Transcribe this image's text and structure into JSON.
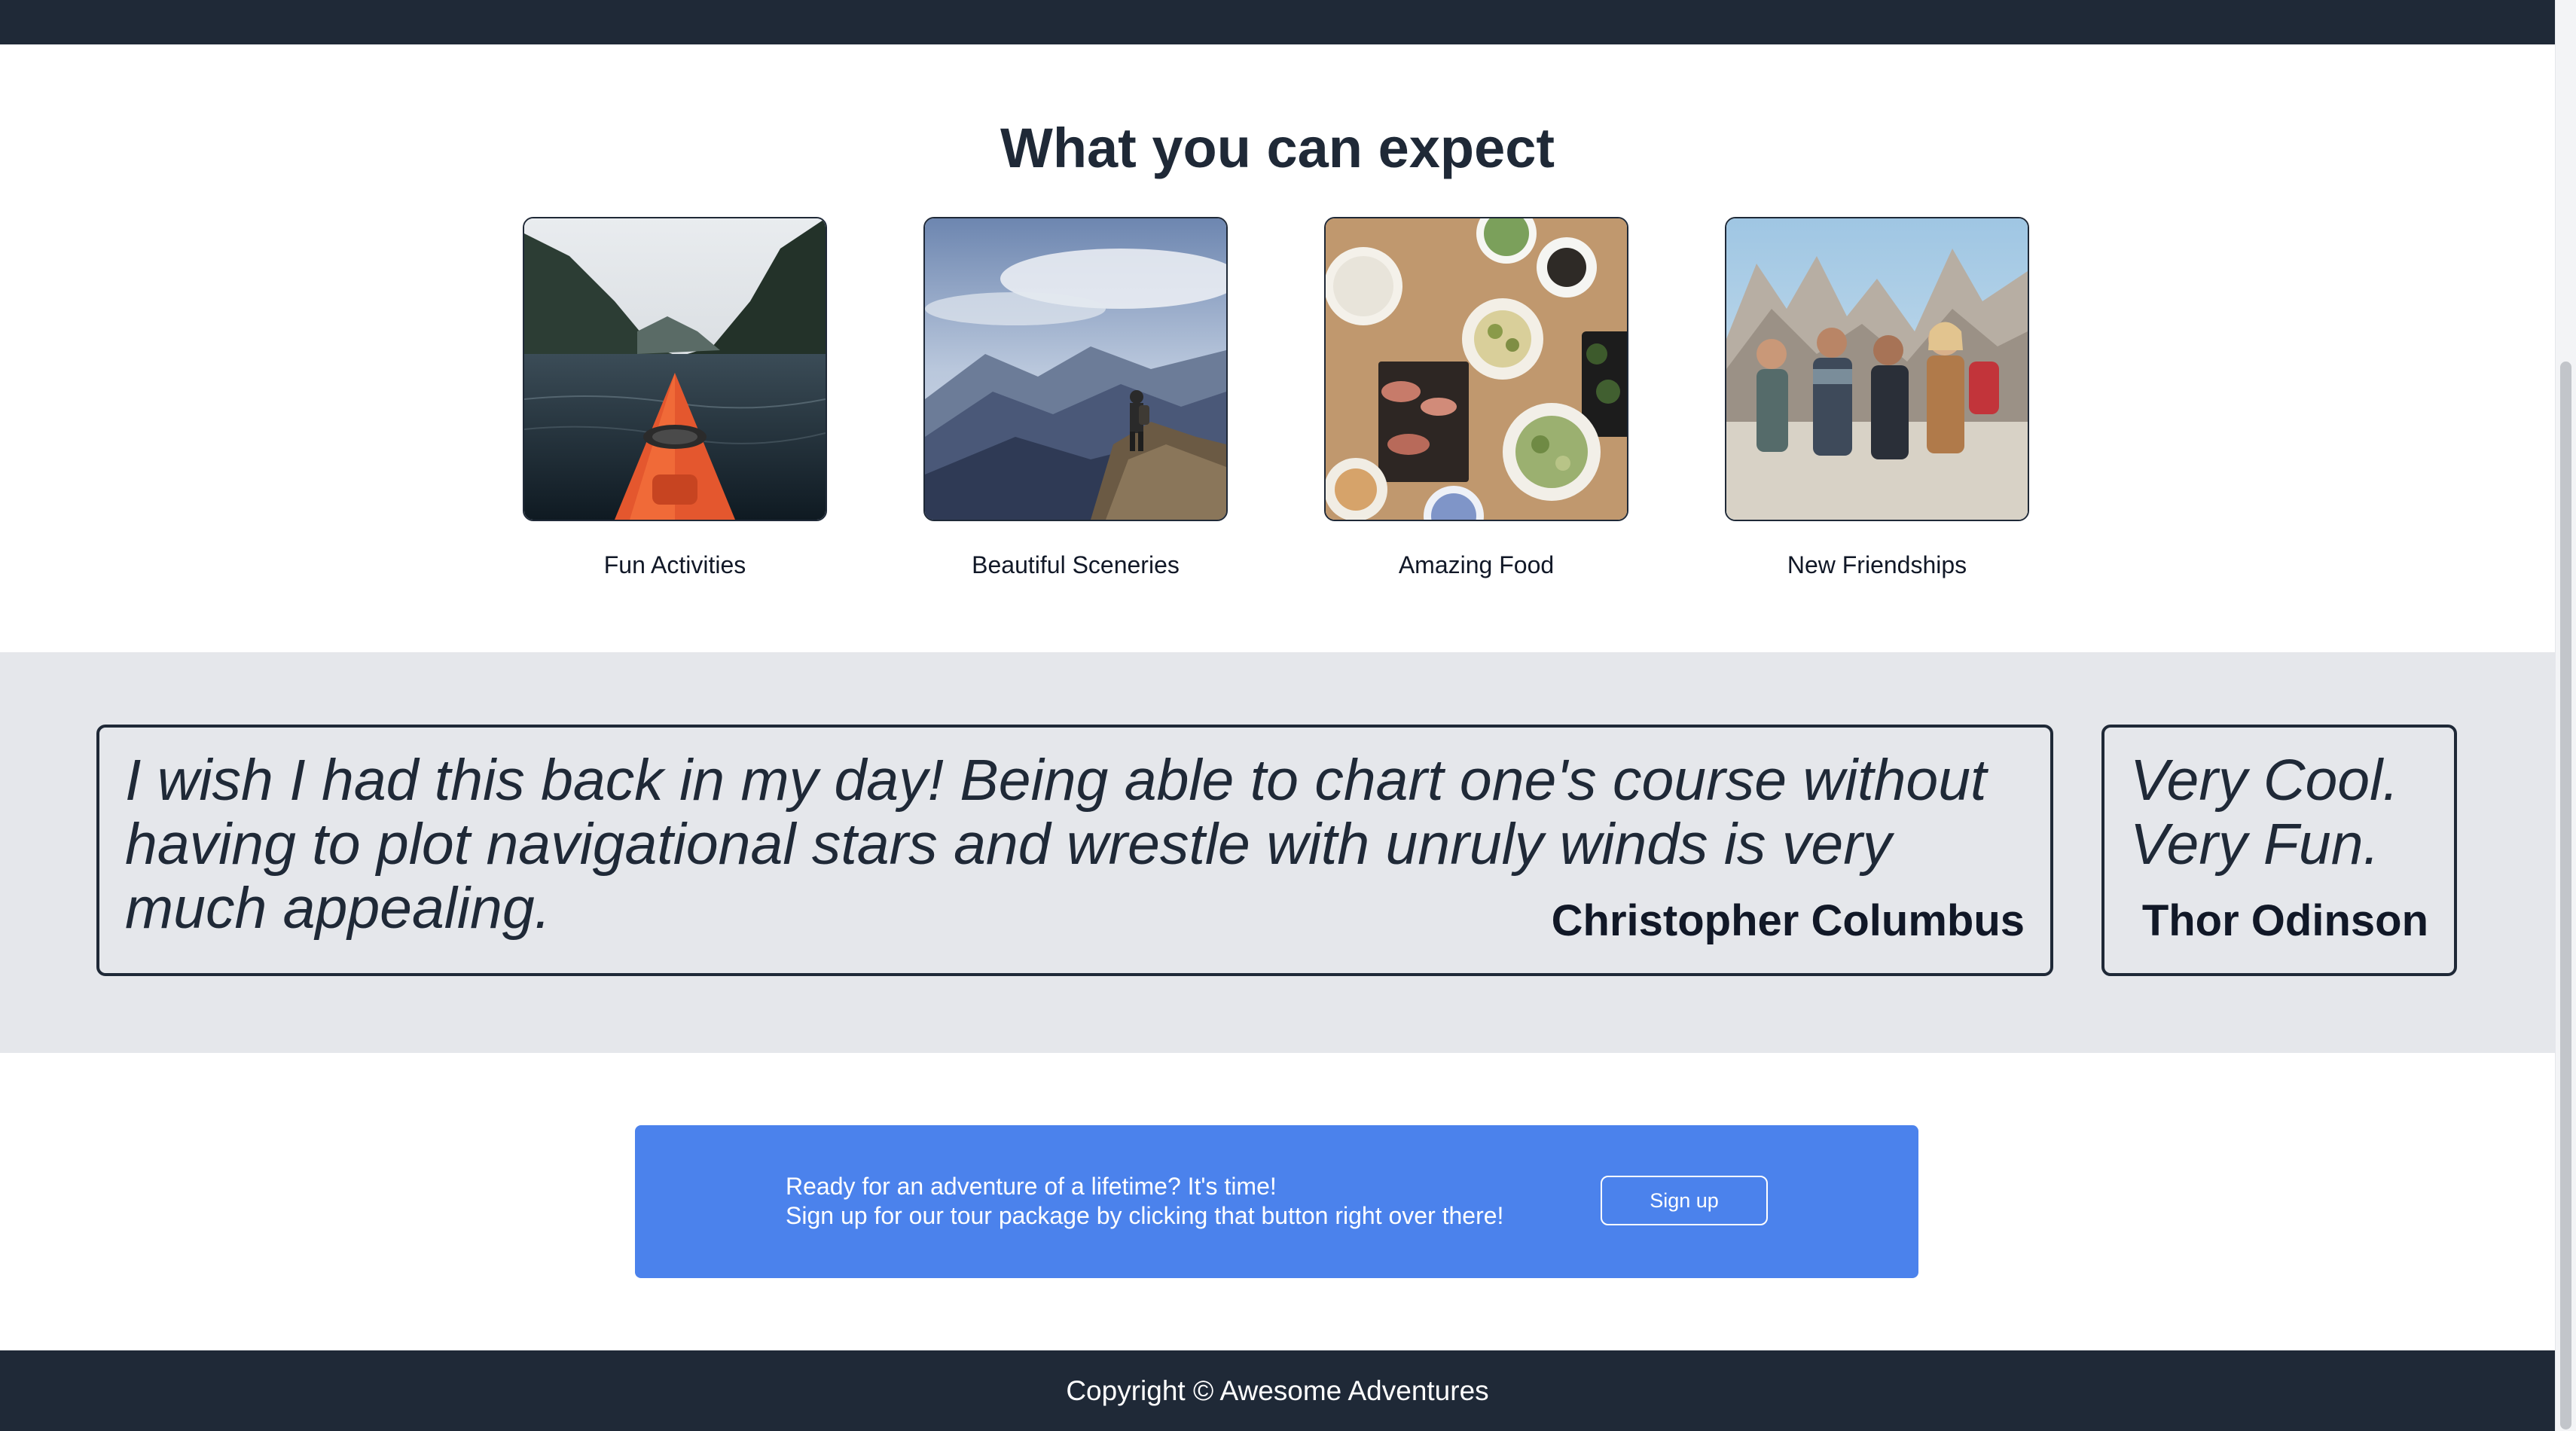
{
  "features": {
    "title": "What you can expect",
    "items": [
      {
        "label": "Fun Activities",
        "image": "kayak-in-fjord"
      },
      {
        "label": "Beautiful Sceneries",
        "image": "hiker-on-mountain-ridge"
      },
      {
        "label": "Amazing Food",
        "image": "food-table-top-view"
      },
      {
        "label": "New Friendships",
        "image": "group-of-friends-hiking"
      }
    ]
  },
  "testimonials": [
    {
      "quote": "I wish I had this back in my day! Being able to chart one's course without having to plot navigational stars and wrestle with unruly winds is very much appealing.",
      "author": "Christopher Columbus"
    },
    {
      "quote_line1": "Very Cool.",
      "quote_line2": "Very Fun.",
      "author": "Thor Odinson"
    }
  ],
  "cta": {
    "line1": "Ready for an adventure of a lifetime? It's time!",
    "line2": "Sign up for our tour package by clicking that button right over there!",
    "button_label": "Sign up"
  },
  "footer": {
    "copyright": "Copyright © Awesome Adventures"
  },
  "colors": {
    "navbar": "#1f2937",
    "testimonial_bg": "#e5e7eb",
    "cta_bg": "#4b82ec",
    "text_dark": "#1f2937"
  }
}
